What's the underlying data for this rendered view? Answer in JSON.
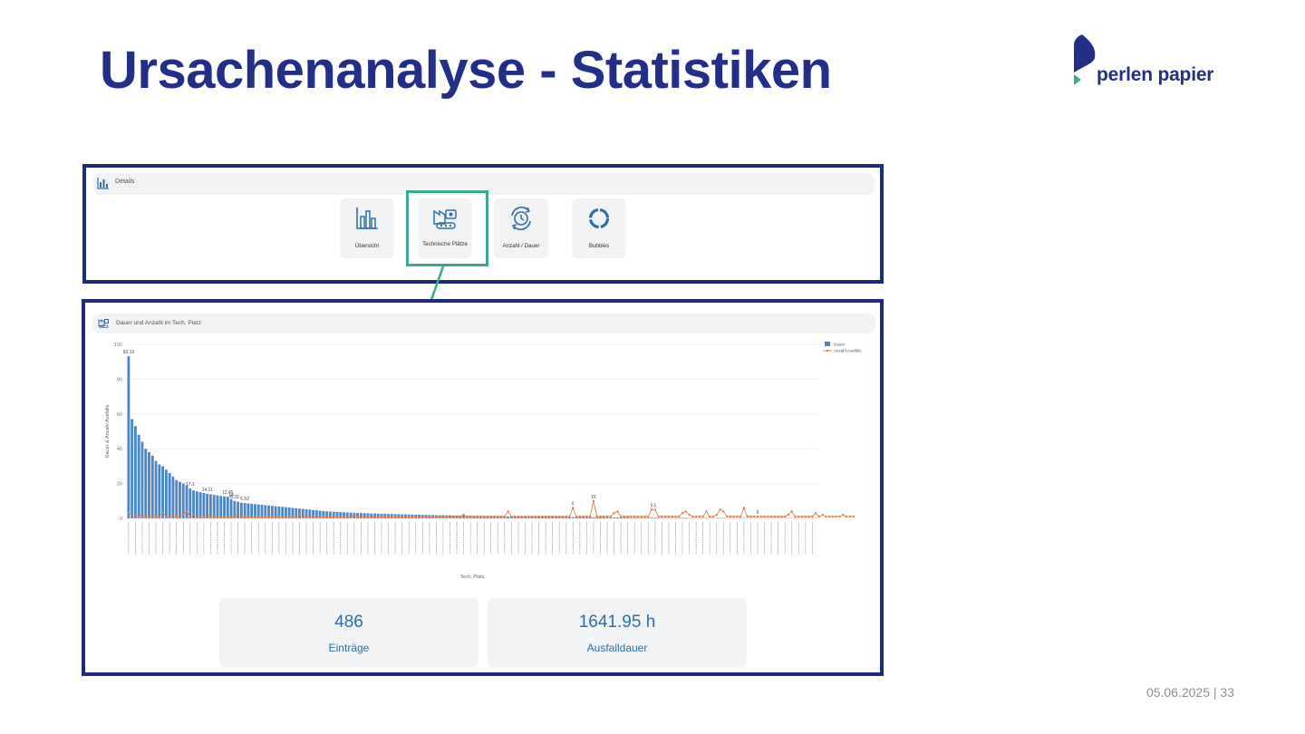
{
  "slide": {
    "title": "Ursachenanalyse - Statistiken",
    "logo_text": "perlen papier",
    "footer": "05.06.2025 | 33"
  },
  "details": {
    "header_label": "Details",
    "tiles": [
      {
        "label": "Übersicht",
        "icon": "bar-chart-icon"
      },
      {
        "label": "Technische Plätze",
        "icon": "factory-machine-icon"
      },
      {
        "label": "Anzahl / Dauer",
        "icon": "clock-cycle-icon"
      },
      {
        "label": "Bubbles",
        "icon": "donut-icon"
      }
    ],
    "selected": "Technische Plätze",
    "colors": {
      "highlight": "#3aa893",
      "icon": "#2f6fa6",
      "frame": "#1e2a7a"
    }
  },
  "chart_panel": {
    "title": "Dauer und Anzahl im Tech. Platz"
  },
  "chart_data": {
    "type": "bar",
    "xlabel": "Tech. Platz",
    "ylabel": "Dauer & Anzahl Ausfälle",
    "ylim": [
      0,
      100
    ],
    "yticks": [
      0,
      20,
      40,
      60,
      80,
      100
    ],
    "legend": [
      "Dauer",
      "Anzahl Ausfälle"
    ],
    "legend_position": "top-right",
    "series": [
      {
        "name": "Dauer",
        "kind": "bar",
        "color": "#4a86c8",
        "values": [
          93.19,
          57,
          53,
          48,
          44,
          40,
          38,
          36,
          33,
          31,
          30,
          28,
          26,
          24,
          22,
          21,
          20,
          19,
          17.1,
          16,
          15.5,
          15,
          14.6,
          14.11,
          13.8,
          13.5,
          13.2,
          12.9,
          12.6,
          12.45,
          11,
          10,
          9.5,
          9,
          8.8,
          8.6,
          8.4,
          8.2,
          8,
          7.8,
          7.6,
          7.4,
          7.2,
          7,
          6.8,
          6.6,
          6.4,
          6.2,
          6,
          5.8,
          5.6,
          5.4,
          5.2,
          5,
          4.8,
          4.6,
          4.4,
          4.2,
          4,
          3.9,
          3.8,
          3.7,
          3.6,
          3.5,
          3.4,
          3.3,
          3.2,
          3.1,
          3,
          3,
          2.9,
          2.8,
          2.8,
          2.7,
          2.6,
          2.6,
          2.5,
          2.5,
          2.4,
          2.4,
          2.3,
          2.3,
          2.2,
          2.2,
          2.1,
          2.1,
          2,
          2,
          1.9,
          1.9,
          1.8,
          1.8,
          1.8,
          1.7,
          1.7,
          1.6,
          1.6,
          1.6,
          1.5,
          1.5,
          1.5,
          1.4,
          1.4,
          1.4,
          1.3,
          1.3,
          1.3,
          1.2,
          1.2,
          1.2,
          1.1,
          1.1,
          1.1,
          1.1,
          1,
          1,
          1,
          1,
          0.9,
          0.9,
          0.9,
          0.9,
          0.9,
          0.8,
          0.8,
          0.8,
          0.8,
          0.8,
          0.7,
          0.7,
          0.7,
          0.7,
          0.7,
          0.7,
          0.6,
          0.6,
          0.6,
          0.6,
          0.6,
          0.6,
          0.5,
          0.5,
          0.5,
          0.5,
          0.5,
          0.5,
          0.5,
          0.4,
          0.4,
          0.4,
          0.4,
          0.4,
          0.4,
          0.4,
          0.4,
          0.3,
          0.3,
          0.3,
          0.3,
          0.3,
          0.3,
          0.3,
          0.3,
          0.3,
          0.2,
          0.2,
          0.2,
          0.2,
          0.2,
          0.2,
          0.2,
          0.2,
          0.2,
          0.2,
          0.2,
          0.1,
          0.1,
          0.1,
          0.1,
          0.1,
          0.1,
          0.1,
          0.1,
          0.1,
          0.1,
          0.1,
          0.1,
          0.1,
          0.1,
          0.1,
          0.1,
          0.1,
          0.1,
          0.1,
          0.1,
          0.1,
          0.1,
          0.1,
          0.1,
          0.1,
          0.1,
          0.1
        ]
      },
      {
        "name": "Anzahl Ausfälle",
        "kind": "line",
        "color": "#e8743b",
        "values": [
          3,
          2,
          2,
          1,
          2,
          1,
          1,
          2,
          1,
          1,
          3,
          1,
          1,
          2,
          1,
          1,
          2,
          4,
          1,
          2,
          1,
          1,
          1,
          2,
          1,
          1,
          1,
          1,
          1,
          1,
          1,
          1,
          2,
          1,
          1,
          1,
          1,
          1,
          1,
          1,
          1,
          1,
          1,
          1,
          1,
          1,
          1,
          1,
          1,
          1,
          2,
          1,
          1,
          1,
          1,
          1,
          1,
          1,
          1,
          1,
          1,
          1,
          1,
          1,
          1,
          1,
          2,
          1,
          1,
          1,
          1,
          1,
          1,
          1,
          1,
          1,
          1,
          1,
          1,
          1,
          1,
          1,
          1,
          1,
          1,
          1,
          1,
          1,
          1,
          1,
          1,
          1,
          1,
          1,
          1,
          1,
          1,
          1,
          2,
          1,
          1,
          1,
          1,
          1,
          1,
          1,
          1,
          1,
          1,
          1,
          1,
          4,
          1,
          1,
          1,
          1,
          1,
          1,
          1,
          1,
          1,
          1,
          1,
          1,
          1,
          1,
          1,
          1,
          1,
          1,
          6,
          1,
          1,
          1,
          1,
          1,
          10,
          1,
          1,
          1,
          1,
          1,
          3,
          4,
          1,
          1,
          1,
          1,
          1,
          1,
          1,
          1,
          1,
          5,
          5,
          1,
          1,
          1,
          1,
          1,
          1,
          1,
          3,
          4,
          2,
          1,
          1,
          1,
          1,
          4,
          1,
          1,
          2,
          5,
          4,
          1,
          1,
          1,
          1,
          1,
          6,
          1,
          1,
          1,
          1,
          1,
          1,
          1,
          1,
          1,
          1,
          1,
          1,
          2,
          4,
          1,
          1,
          1,
          1,
          1,
          1,
          3,
          1,
          2,
          1,
          1,
          1,
          1,
          1,
          2,
          1,
          1,
          1
        ]
      }
    ],
    "data_labels": [
      {
        "index": 0,
        "text": "93.19"
      },
      {
        "index": 18,
        "text": "17.1"
      },
      {
        "index": 23,
        "text": "14.11"
      },
      {
        "index": 29,
        "text": "12.45"
      },
      {
        "index": 30,
        "text": "14"
      },
      {
        "index": 31,
        "text": "8.33"
      },
      {
        "index": 34,
        "text": "6.52"
      },
      {
        "index": 130,
        "text": "6"
      },
      {
        "index": 136,
        "text": "10"
      },
      {
        "index": 153,
        "text": "5"
      },
      {
        "index": 154,
        "text": "5"
      },
      {
        "index": 184,
        "text": "6"
      }
    ],
    "grid": true
  },
  "kpis": [
    {
      "value": "486",
      "label": "Einträge"
    },
    {
      "value": "1641.95 h",
      "label": "Ausfalldauer"
    }
  ]
}
